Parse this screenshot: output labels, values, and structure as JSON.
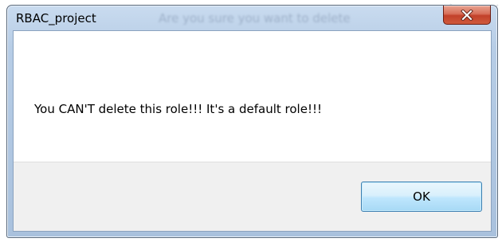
{
  "dialog": {
    "title": "RBAC_project",
    "title_ghost_text": "Are you sure you want to delete",
    "message": "You CAN'T delete this role!!! It's a default role!!!",
    "ok_label": "OK",
    "close_icon": "close-icon"
  },
  "colors": {
    "close_button": "#c2412a",
    "ok_border": "#3c7fb1",
    "frame": "#a9c1dd"
  }
}
